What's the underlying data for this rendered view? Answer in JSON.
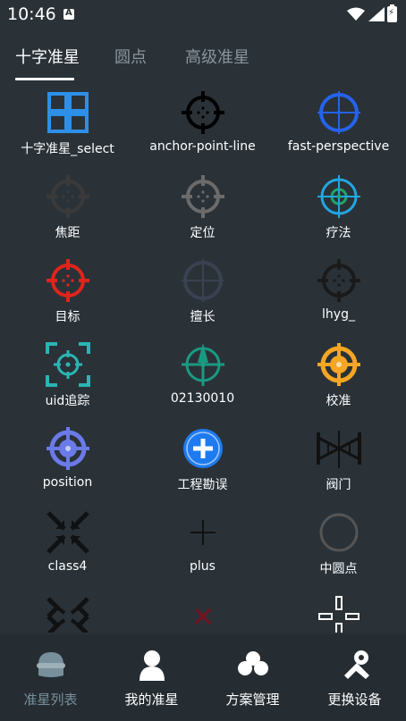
{
  "status": {
    "time": "10:46"
  },
  "tabs": [
    {
      "label": "十字准星"
    },
    {
      "label": "圆点"
    },
    {
      "label": "高级准星"
    }
  ],
  "crosshairs": [
    {
      "label": "十字准星_select",
      "icon": "grid-square-icon",
      "color": "#2e8fe8"
    },
    {
      "label": "anchor-point-line",
      "icon": "crosshair-dots-icon",
      "color": "#000000"
    },
    {
      "label": "fast-perspective",
      "icon": "crosshair-circle-icon",
      "color": "#2563eb"
    },
    {
      "label": "焦距",
      "icon": "crosshair-dots-icon",
      "color": "#3a3a3a"
    },
    {
      "label": "定位",
      "icon": "crosshair-dots-icon",
      "color": "#6b6b6b"
    },
    {
      "label": "疗法",
      "icon": "crosshair-double-icon",
      "color": "#22a6e0"
    },
    {
      "label": "目标",
      "icon": "crosshair-dots-icon",
      "color": "#e0241b"
    },
    {
      "label": "擅长",
      "icon": "crosshair-circle-icon",
      "color": "#3a4150"
    },
    {
      "label": "lhyg_",
      "icon": "crosshair-dots-icon",
      "color": "#1a1a1a"
    },
    {
      "label": "uid追踪",
      "icon": "bracket-target-icon",
      "color": "#2ab5b5"
    },
    {
      "label": "02130010",
      "icon": "arrow-target-icon",
      "color": "#1a9a80"
    },
    {
      "label": "校准",
      "icon": "filled-target-icon",
      "color": "#f5a623"
    },
    {
      "label": "position",
      "icon": "filled-target-icon",
      "color": "#6a7be8"
    },
    {
      "label": "工程勘误",
      "icon": "plus-badge-icon",
      "color": "#1e7af0"
    },
    {
      "label": "阀门",
      "icon": "valve-icon",
      "color": "#111111"
    },
    {
      "label": "class4",
      "icon": "arrows-in-icon",
      "color": "#111111"
    },
    {
      "label": "plus",
      "icon": "plus-thin-icon",
      "color": "#111111"
    },
    {
      "label": "中圆点",
      "icon": "ring-icon",
      "color": "#555555"
    },
    {
      "label": "",
      "icon": "double-arrows-in-icon",
      "color": "#111111"
    },
    {
      "label": "",
      "icon": "x-small-icon",
      "color": "#7a1020"
    },
    {
      "label": "",
      "icon": "gap-cross-icon",
      "color": "#ffffff"
    }
  ],
  "nav": [
    {
      "label": "准星列表",
      "icon": "hat-icon"
    },
    {
      "label": "我的准星",
      "icon": "person-icon"
    },
    {
      "label": "方案管理",
      "icon": "cloud-icon"
    },
    {
      "label": "更换设备",
      "icon": "tools-icon"
    }
  ]
}
